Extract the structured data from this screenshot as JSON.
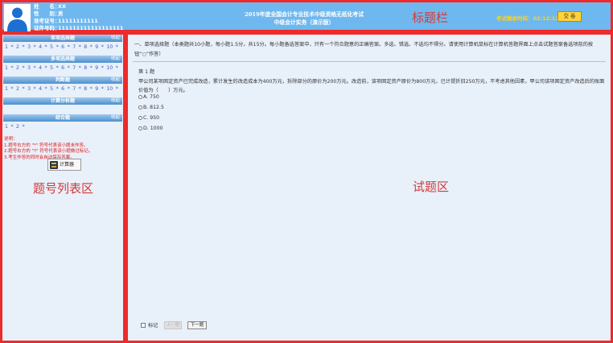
{
  "header": {
    "candidate": [
      {
        "label": "姓　　名：",
        "value": "XX"
      },
      {
        "label": "性　　别：",
        "value": "男"
      },
      {
        "label": "准考证号：",
        "value": "11111111111"
      },
      {
        "label": "证件号码：",
        "value": "111111111111111111"
      }
    ],
    "title_line1": "2019年度全国会计专业技术中级资格无纸化考试",
    "title_line2": "中级会计实务（演示版）",
    "zone_label": "标题栏",
    "timer_label": "考试剩余时间：",
    "timer_value": "02:12:12",
    "submit_label": "交 卷"
  },
  "sidebar": {
    "zone_label": "题号列表区",
    "collapse_label": "收起",
    "sections": [
      {
        "title": "单项选择题",
        "numbers": [
          "1",
          "2",
          "3",
          "4",
          "5",
          "6",
          "7",
          "8",
          "9",
          "10"
        ]
      },
      {
        "title": "多项选择题",
        "numbers": [
          "1",
          "2",
          "3",
          "4",
          "5",
          "6",
          "7",
          "8",
          "9",
          "10"
        ]
      },
      {
        "title": "判断题",
        "numbers": [
          "1",
          "2",
          "3",
          "4",
          "5",
          "6",
          "7",
          "8",
          "9",
          "10"
        ]
      },
      {
        "title": "计算分析题",
        "numbers": []
      },
      {
        "title": "综合题",
        "numbers": [
          "1",
          "2"
        ]
      }
    ],
    "notes": [
      "说明：",
      "1.题号右方的 \"*\" 符号代表该小题未作答。",
      "2.题号右方的 \"?\" 符号代表该小题做过标记。",
      "3.考生作答的同时会自动保存答案。"
    ],
    "calculator_label": "计算器"
  },
  "main": {
    "zone_label": "试题区",
    "instructions": "一、单项选择题（本类题共10小题，每小题1.5分，共15分。每小题备选答案中，只有一个符合题意的正确答案。多选、错选、不选均不得分。请使用计算机鼠标在计算机答题界面上点击试题答案备选项前的按钮“○”作答）",
    "question_number": "第 1 题",
    "question_text": "甲公司某项固定资产已完成改造，累计发生的改造成本为400万元，拆除部分的原价为200万元。改造前，该项固定资产原价为800万元，已计提折旧250万元，不考虑其他因素，甲公司该项固定资产改造后的账面价值为（　　）万元。",
    "options": [
      "A. 750",
      "B. 812.5",
      "C. 950",
      "D. 1000"
    ],
    "mark_label": "标记",
    "prev_label": "上一题",
    "next_label": "下一题"
  }
}
